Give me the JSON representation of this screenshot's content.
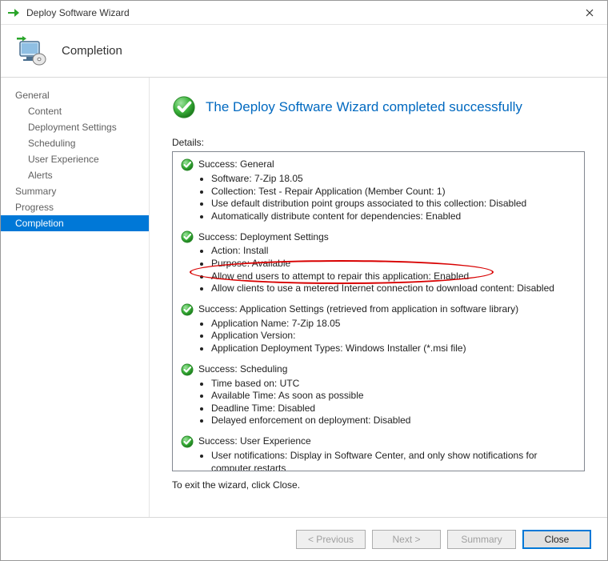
{
  "window": {
    "title": "Deploy Software Wizard",
    "step_title": "Completion"
  },
  "sidebar": {
    "items": [
      {
        "label": "General",
        "child": false
      },
      {
        "label": "Content",
        "child": true
      },
      {
        "label": "Deployment Settings",
        "child": true
      },
      {
        "label": "Scheduling",
        "child": true
      },
      {
        "label": "User Experience",
        "child": true
      },
      {
        "label": "Alerts",
        "child": true
      },
      {
        "label": "Summary",
        "child": false
      },
      {
        "label": "Progress",
        "child": false
      },
      {
        "label": "Completion",
        "child": false,
        "selected": true
      }
    ]
  },
  "main": {
    "success_headline": "The Deploy Software Wizard completed successfully",
    "details_label": "Details:",
    "hint": "To exit the wizard, click Close.",
    "groups": [
      {
        "title": "Success: General",
        "items": [
          "Software: 7-Zip 18.05",
          "Collection: Test - Repair Application (Member Count: 1)",
          "Use default distribution point groups associated to this collection: Disabled",
          "Automatically distribute content for dependencies: Enabled"
        ]
      },
      {
        "title": "Success: Deployment Settings",
        "items": [
          "Action: Install",
          "Purpose: Available",
          "Allow end users to attempt to repair this application: Enabled",
          "Allow clients to use a metered Internet connection to download content: Disabled"
        ],
        "highlight_index": 2
      },
      {
        "title": "Success: Application Settings (retrieved from application in software library)",
        "items": [
          "Application Name: 7-Zip 18.05",
          "Application Version:",
          "Application Deployment Types: Windows Installer (*.msi file)"
        ]
      },
      {
        "title": "Success: Scheduling",
        "items": [
          "Time based on: UTC",
          "Available Time: As soon as possible",
          "Deadline Time: Disabled",
          "Delayed enforcement on deployment: Disabled"
        ]
      },
      {
        "title": "Success: User Experience",
        "items": [
          "User notifications: Display in Software Center, and only show notifications for computer restarts"
        ]
      }
    ]
  },
  "footer": {
    "previous": "< Previous",
    "next": "Next >",
    "summary": "Summary",
    "close": "Close"
  }
}
